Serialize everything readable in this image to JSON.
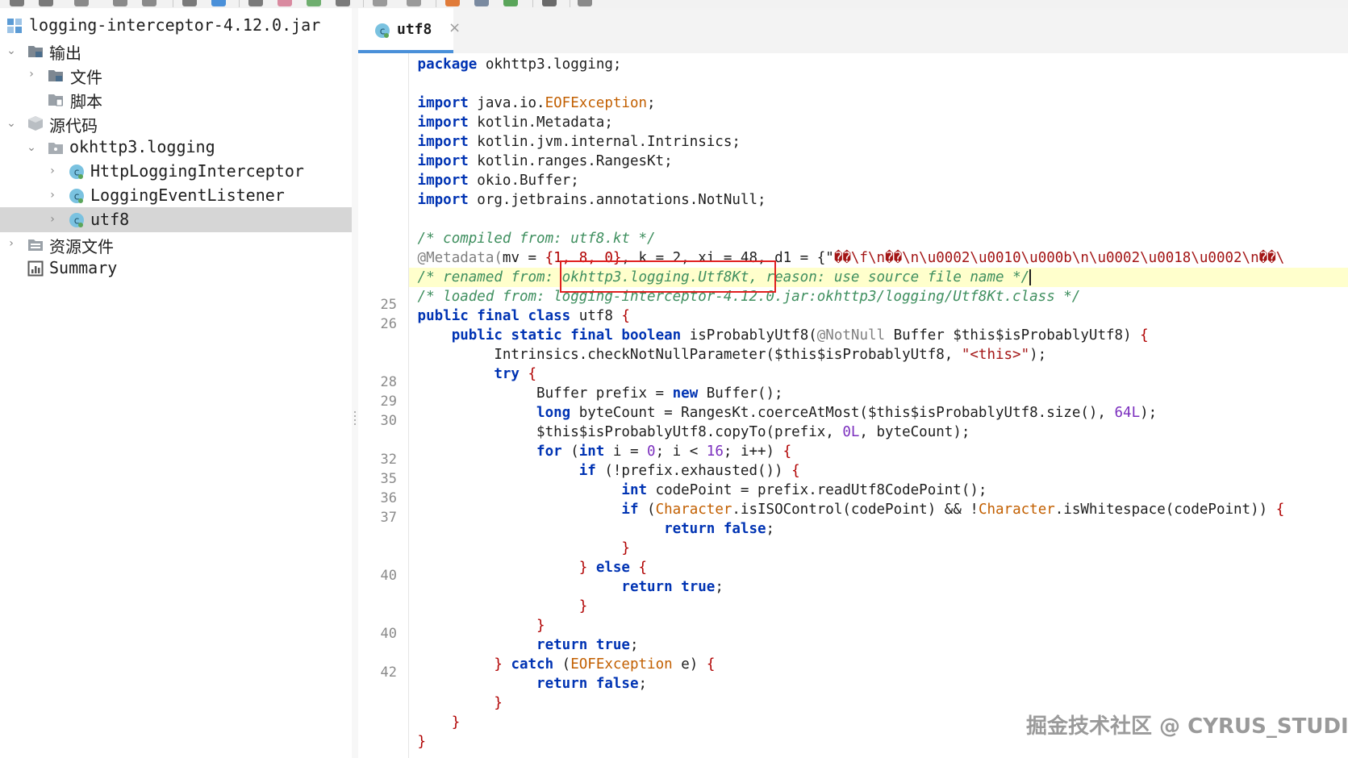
{
  "toolbar": {
    "icons": [
      "save-icon",
      "refresh-icon",
      "open-icon",
      "close-icon",
      "expand-icon",
      "structure-icon",
      "search-icon",
      "find-icon",
      "find-usages-icon",
      "back-icon",
      "forward-icon",
      "settings-icon",
      "image-icon",
      "android-icon",
      "terminal-icon",
      "tools-icon"
    ]
  },
  "tree": {
    "root": {
      "label": "logging-interceptor-4.12.0.jar",
      "icon": "module-icon"
    },
    "items": [
      {
        "label": "输出",
        "icon": "folder-icon"
      },
      {
        "label": "文件",
        "icon": "folder-icon"
      },
      {
        "label": "脚本",
        "icon": "script-folder-icon"
      },
      {
        "label": "源代码",
        "icon": "package-box-icon"
      },
      {
        "label": "okhttp3.logging",
        "icon": "package-icon"
      },
      {
        "label": "HttpLoggingInterceptor",
        "icon": "class-icon"
      },
      {
        "label": "LoggingEventListener",
        "icon": "class-icon"
      },
      {
        "label": "utf8",
        "icon": "class-icon"
      },
      {
        "label": "资源文件",
        "icon": "folder-icon"
      },
      {
        "label": "Summary",
        "icon": "summary-icon"
      }
    ]
  },
  "editor": {
    "tab": {
      "label": "utf8",
      "close": "×"
    },
    "line_numbers": [
      "25",
      "26",
      "28",
      "29",
      "30",
      "32",
      "35",
      "36",
      "37",
      "40",
      "40",
      "42"
    ],
    "code": {
      "l1_kw": "package",
      "l1_rest": " okhttp3.logging;",
      "imp_kw": "import",
      "imp1_a": " java.io.",
      "imp1_b": "EOFException",
      "imp1_c": ";",
      "imp2": " kotlin.Metadata;",
      "imp3": " kotlin.jvm.internal.Intrinsics;",
      "imp4": " kotlin.ranges.RangesKt;",
      "imp5": " okio.Buffer;",
      "imp6": " org.jetbrains.annotations.NotNull;",
      "compiled": "/* compiled from: utf8.kt */",
      "meta_a": "@Metadata(",
      "meta_b": "mv = ",
      "meta_c": "{1, 8, 0}",
      "meta_d": ", k = 2, xi = 48, d1 = {\"",
      "meta_e": "��\\f\\n��\\n\\u0002\\u0010\\u000b\\n\\u0002\\u0018\\u0002\\n��\\",
      "renamed_a": "/* renamed from: ",
      "renamed_b": "okhttp3.logging.Utf8Kt,",
      "renamed_c": " reason: use source file name */",
      "loaded": "/* loaded from: logging-interceptor-4.12.0.jar:okhttp3/logging/Utf8Kt.class */",
      "cls_kw": "public final class",
      "cls_name": " utf8 ",
      "brace_open": "{",
      "brace_close": "}",
      "m_kw1": "public static final",
      "m_kw2": "boolean",
      "m_name": " isProbablyUtf8(",
      "m_ann": "@NotNull",
      "m_rest": " Buffer $this$isProbablyUtf8) ",
      "check_a": "Intrinsics.checkNotNullParameter($this$isProbablyUtf8, ",
      "check_str": "\"<this>\"",
      "check_b": ");",
      "try_kw": "try",
      "buf_a": "Buffer prefix = ",
      "new_kw": "new",
      "buf_b": " Buffer();",
      "long_kw": "long",
      "bc_a": " byteCount = RangesKt.coerceAtMost($this$isProbablyUtf8.size(), ",
      "bc_num": "64L",
      "bc_b": ");",
      "copy_a": "$this$isProbablyUtf8.copyTo(prefix, ",
      "copy_num": "0L",
      "copy_b": ", byteCount);",
      "for_kw": "for",
      "int_kw": "int",
      "for_a": " i = ",
      "for_n0": "0",
      "for_b": "; i < ",
      "for_n16": "16",
      "for_c": "; i++) ",
      "if_kw": "if",
      "if1": " (!prefix.exhausted()) ",
      "cp_a": " codePoint = prefix.readUtf8CodePoint();",
      "if2_a": " (",
      "char_cls": "Character",
      "if2_b": ".isISOControl(codePoint) && !",
      "if2_c": ".isWhitespace(codePoint)) ",
      "return_kw": "return",
      "false_kw": "false",
      "true_kw": "true",
      "else_kw": "else",
      "catch_kw": "catch",
      "catch_a": " (",
      "catch_cls": "EOFException",
      "catch_b": " e) ",
      "semi": ";",
      "paren_o": "(",
      "paren_c": ")"
    }
  },
  "watermark": "掘金技术社区 @ CYRUS_STUDIO",
  "colors": {
    "keyword": "#0033b3",
    "comment": "#3f8f5f",
    "highlight_line": "#ffffcc",
    "red_box": "#e02020",
    "tab_underline": "#4a90d9"
  }
}
